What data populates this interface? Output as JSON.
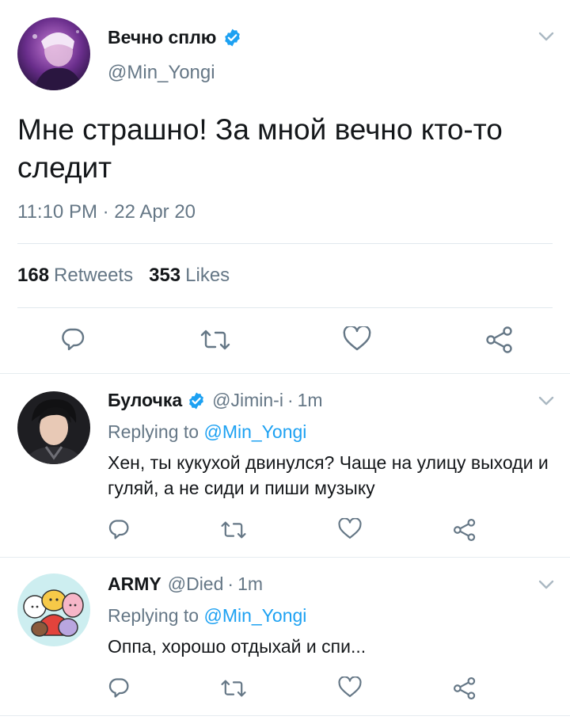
{
  "main_tweet": {
    "display_name": "Вечно сплю",
    "handle": "@Min_Yongi",
    "text": "Мне страшно! За мной вечно кто-то следит",
    "timestamp": "11:10 PM · 22 Apr 20",
    "retweets_count": "168",
    "retweets_label": "Retweets",
    "likes_count": "353",
    "likes_label": "Likes",
    "verified": true
  },
  "replies": [
    {
      "display_name": "Булочка",
      "handle": "@Jimin-i",
      "separator": "·",
      "time": "1m",
      "replying_prefix": "Replying to",
      "replying_to": "@Min_Yongi",
      "text": "Хен, ты кукухой двинулся? Чаще на улицу выходи и гуляй, а не сиди и пиши музыку",
      "verified": true
    },
    {
      "display_name": "ARMY",
      "handle": "@Died",
      "separator": "·",
      "time": "1m",
      "replying_prefix": "Replying to",
      "replying_to": "@Min_Yongi",
      "text": "Оппа, хорошо отдыхай и спи...",
      "verified": false
    }
  ],
  "icons": {
    "reply": "reply-icon",
    "retweet": "retweet-icon",
    "like": "heart-icon",
    "share": "share-icon",
    "more": "chevron-down-icon",
    "verified": "verified-badge-icon"
  },
  "colors": {
    "verified_blue": "#1da1f2",
    "secondary_text": "#657786",
    "icon_gray": "#657786",
    "divider": "#e1e8ed"
  }
}
